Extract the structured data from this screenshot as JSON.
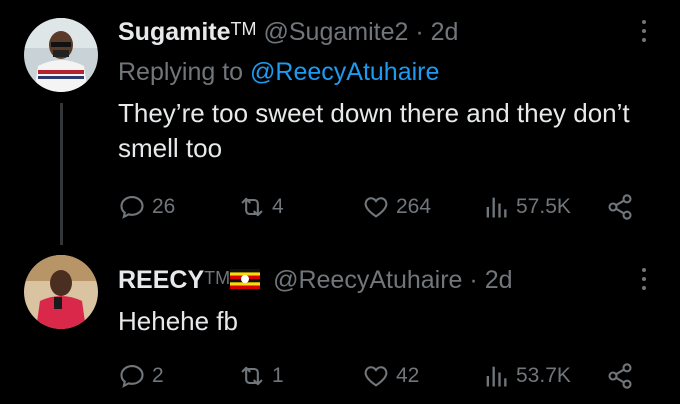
{
  "tweets": [
    {
      "display_name": "Sugamite",
      "name_suffix": "TM",
      "handle": "@Sugamite2",
      "separator": "·",
      "age": "2d",
      "replying_label": "Replying to",
      "replying_to": "@ReecyAtuhaire",
      "text": "They’re too sweet down there and they don’t smell too",
      "replies": "26",
      "retweets": "4",
      "likes": "264",
      "views": "57.5K"
    },
    {
      "display_name": "REECY",
      "name_suffix": "TM",
      "flag": "uganda-flag",
      "handle": "@ReecyAtuhaire",
      "separator": "·",
      "age": "2d",
      "text": "Hehehe fb",
      "replies": "2",
      "retweets": "1",
      "likes": "42",
      "views": "53.7K"
    }
  ],
  "colors": {
    "background": "#000000",
    "text": "#e7e9ea",
    "muted": "#71767b",
    "link": "#1d9bf0",
    "thread_line": "#333639"
  },
  "icons": [
    "more-icon",
    "reply-icon",
    "retweet-icon",
    "like-icon",
    "views-icon",
    "share-icon"
  ]
}
